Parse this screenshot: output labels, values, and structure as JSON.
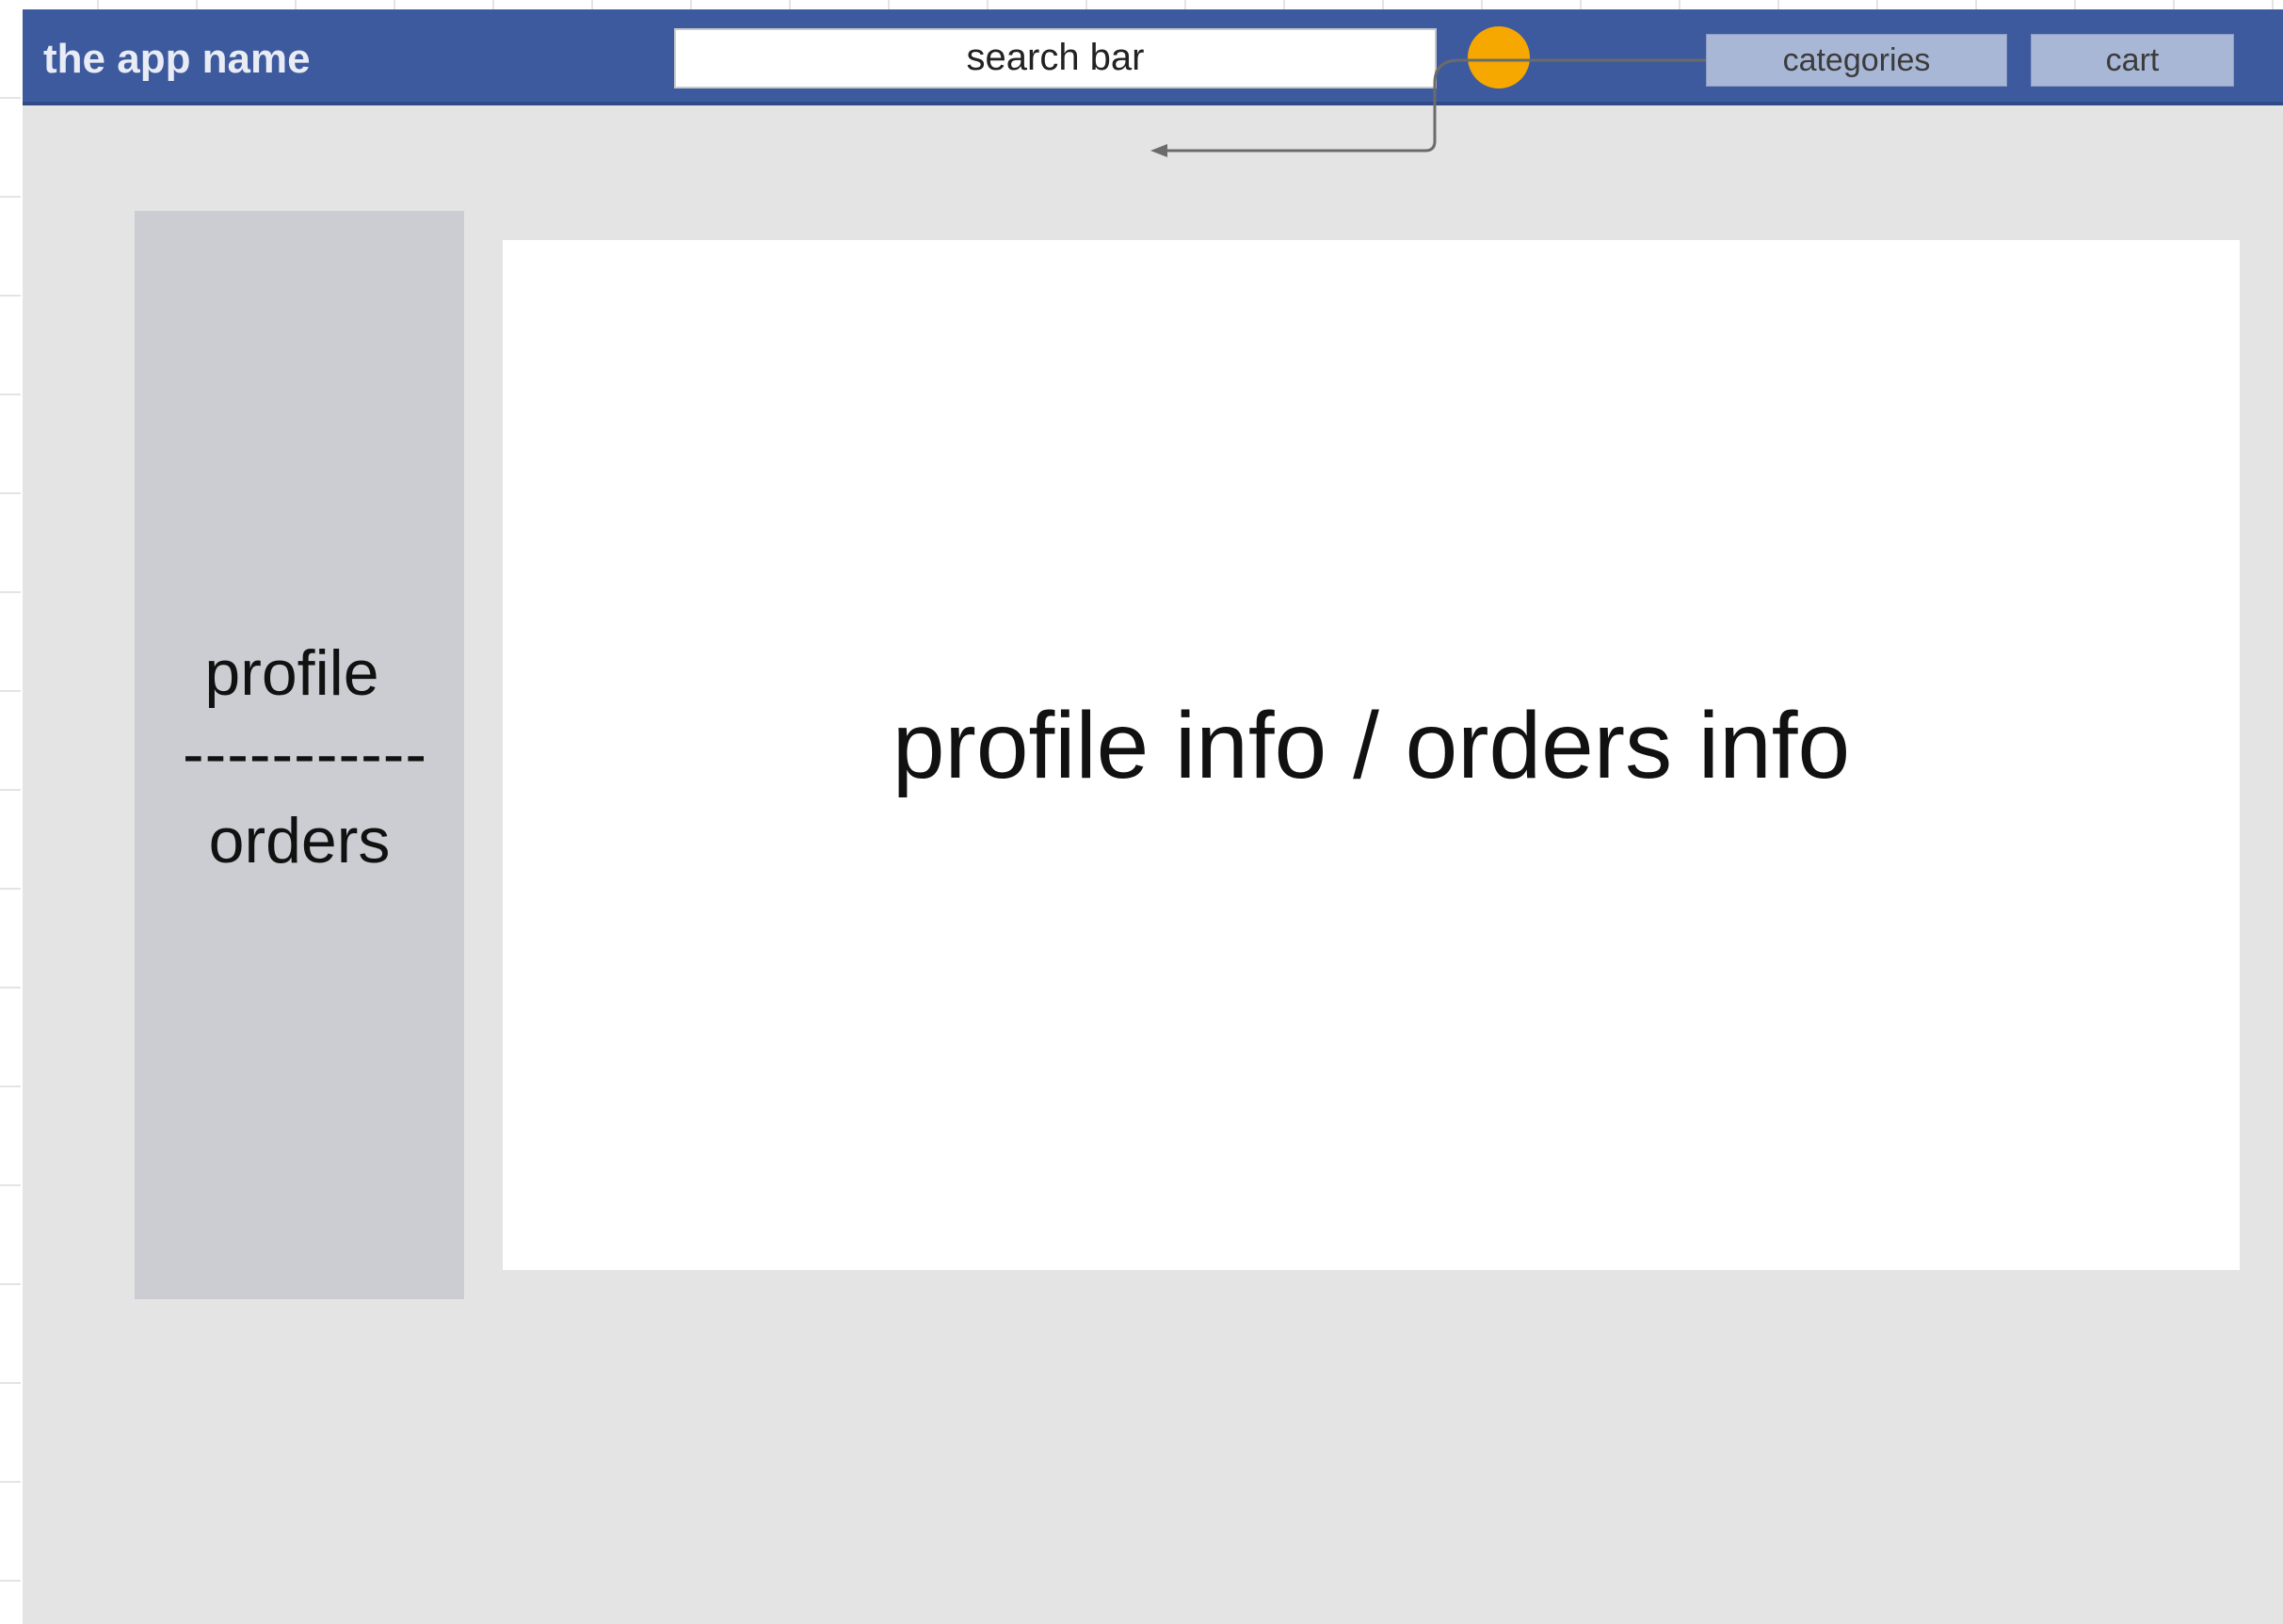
{
  "header": {
    "app_name": "the app name",
    "search": {
      "label": "search bar"
    },
    "search_icon": "search-icon",
    "buttons": {
      "categories": "categories",
      "cart": "cart"
    }
  },
  "sidebar": {
    "profile": "profile",
    "divider": "-----------",
    "orders": "orders"
  },
  "main": {
    "content": "profile info / orders info"
  },
  "colors": {
    "navbar": "#3d5a9e",
    "search_button": "#f7a800",
    "nav_button": "#a9b7d6",
    "sidebar": "#cbcdd2",
    "page_background": "#e4e4e4",
    "content_panel": "#ffffff"
  }
}
